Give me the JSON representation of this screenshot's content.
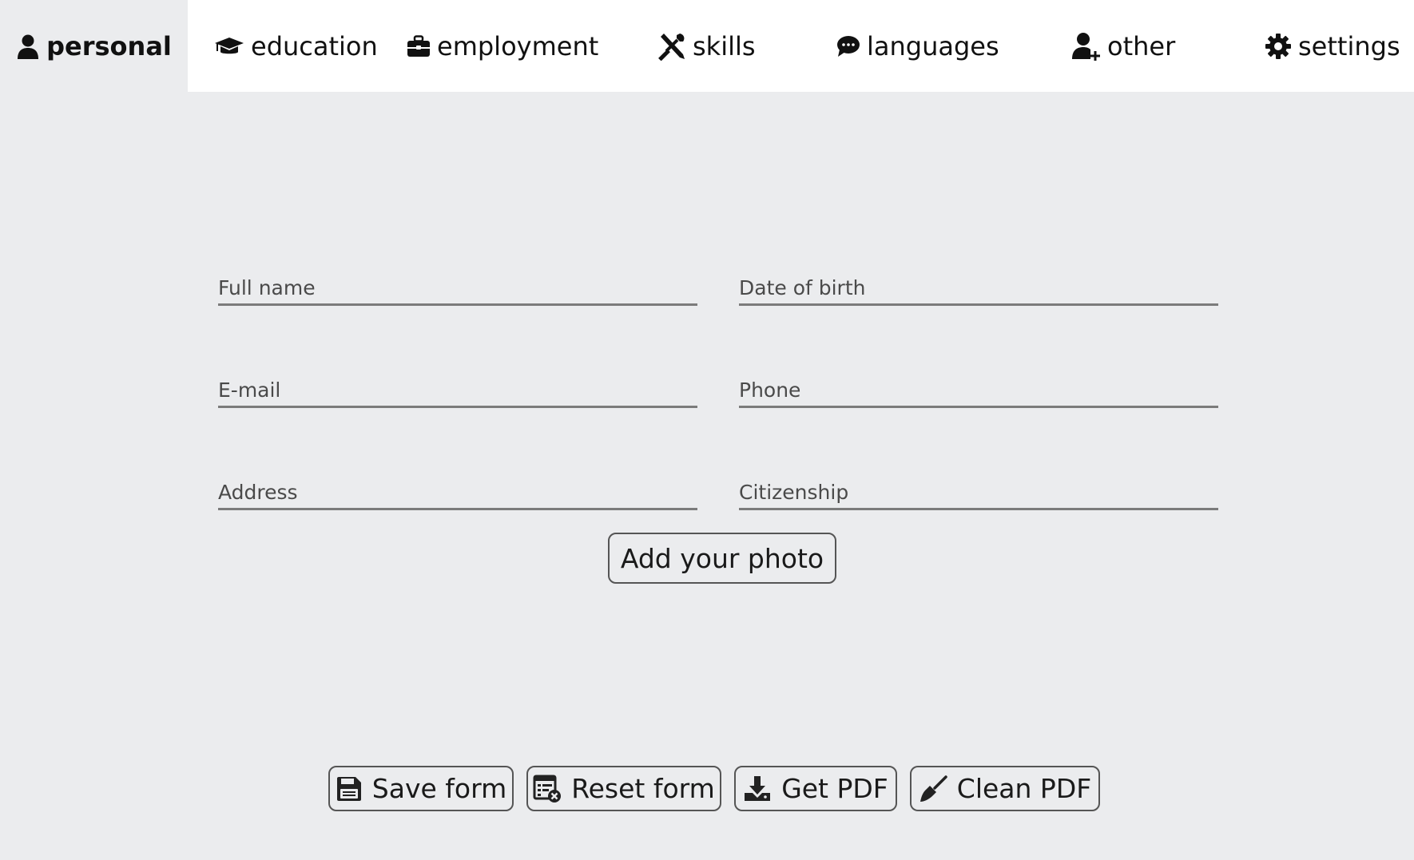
{
  "tabs": [
    {
      "label": "personal",
      "icon": "user-icon",
      "active": true
    },
    {
      "label": "education",
      "icon": "graduation-cap-icon",
      "active": false
    },
    {
      "label": "employment",
      "icon": "briefcase-icon",
      "active": false
    },
    {
      "label": "skills",
      "icon": "tools-icon",
      "active": false
    },
    {
      "label": "languages",
      "icon": "speech-bubble-icon",
      "active": false
    },
    {
      "label": "other",
      "icon": "user-plus-icon",
      "active": false
    },
    {
      "label": "settings",
      "icon": "gear-icon",
      "active": false
    }
  ],
  "form": {
    "full_name": {
      "placeholder": "Full name",
      "value": ""
    },
    "date_of_birth": {
      "placeholder": "Date of birth",
      "value": ""
    },
    "email": {
      "placeholder": "E-mail",
      "value": ""
    },
    "phone": {
      "placeholder": "Phone",
      "value": ""
    },
    "address": {
      "placeholder": "Address",
      "value": ""
    },
    "citizenship": {
      "placeholder": "Citizenship",
      "value": ""
    },
    "add_photo_label": "Add your photo"
  },
  "actions": {
    "save_label": "Save form",
    "reset_label": "Reset form",
    "pdf_label": "Get PDF",
    "clean_label": "Clean PDF"
  },
  "colors": {
    "page_background": "#ebecee",
    "tabbar_background": "#ffffff",
    "field_underline": "#7b7b7b",
    "text": "#111111"
  }
}
